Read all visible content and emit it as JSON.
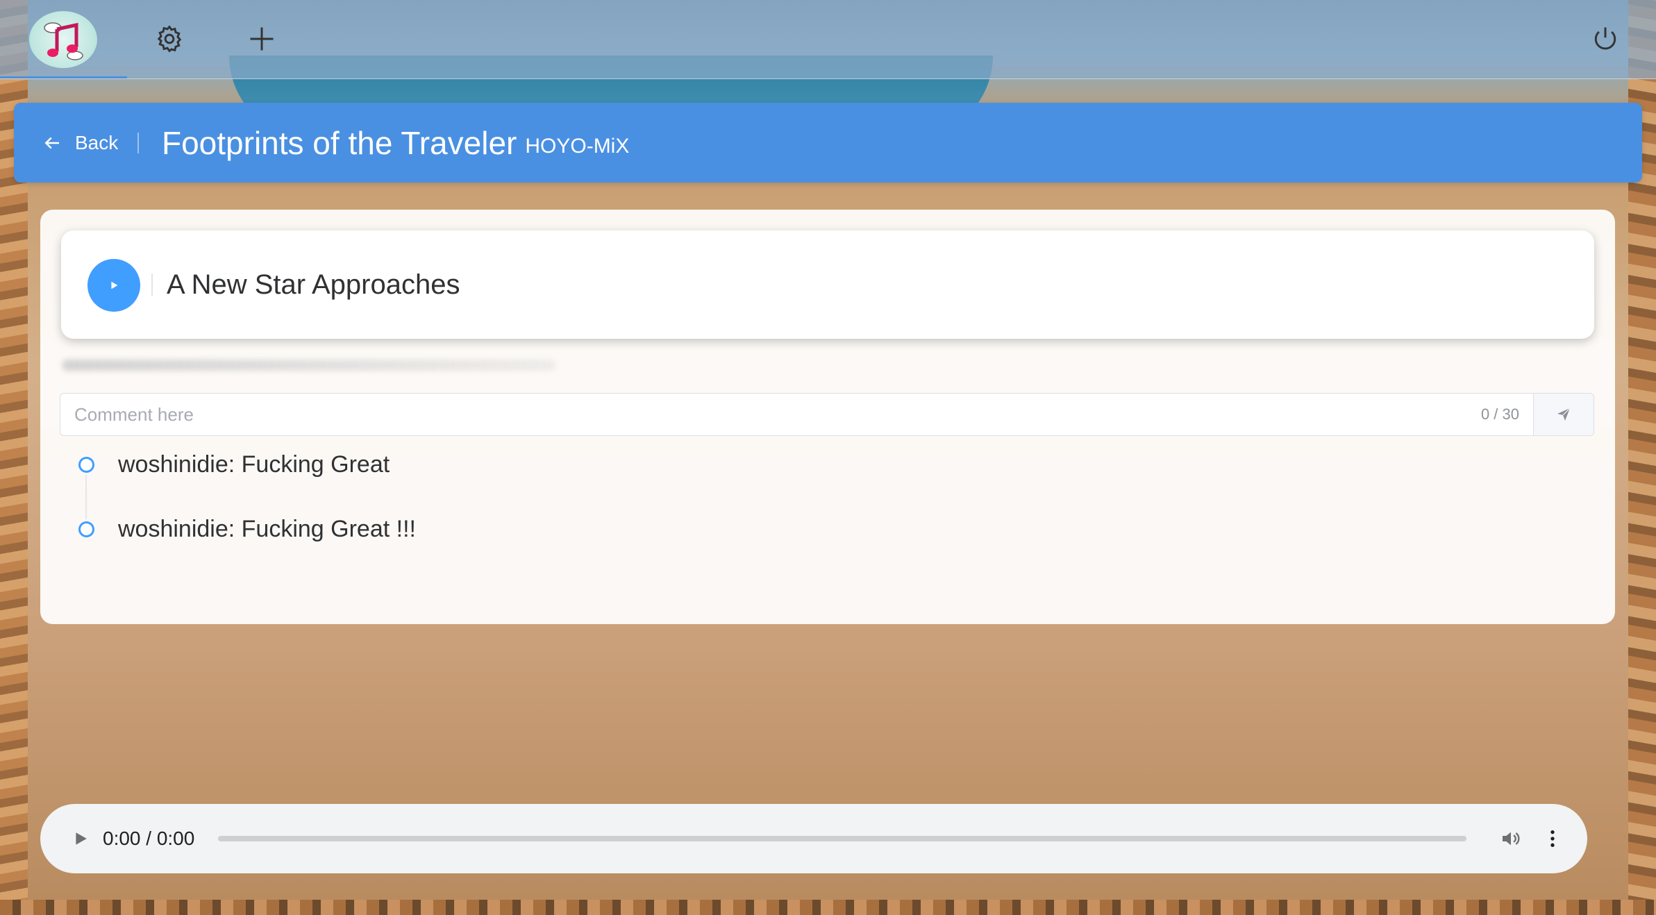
{
  "topbar": {
    "logo_icon": "music-note-cloud-logo",
    "settings_icon": "gear-icon",
    "add_icon": "plus-icon",
    "power_icon": "power-icon"
  },
  "header": {
    "back_label": "Back",
    "title": "Footprints of the Traveler",
    "artist": "HOYO-MiX"
  },
  "song": {
    "title": "A New Star Approaches"
  },
  "comment": {
    "placeholder": "Comment here",
    "counter": "0 / 30"
  },
  "comments": [
    {
      "text": "woshinidie: Fucking Great"
    },
    {
      "text": "woshinidie: Fucking Great !!!"
    }
  ],
  "player": {
    "time": "0:00 / 0:00",
    "progress": 0
  },
  "colors": {
    "accent": "#409eff",
    "header": "#4a90e2"
  }
}
